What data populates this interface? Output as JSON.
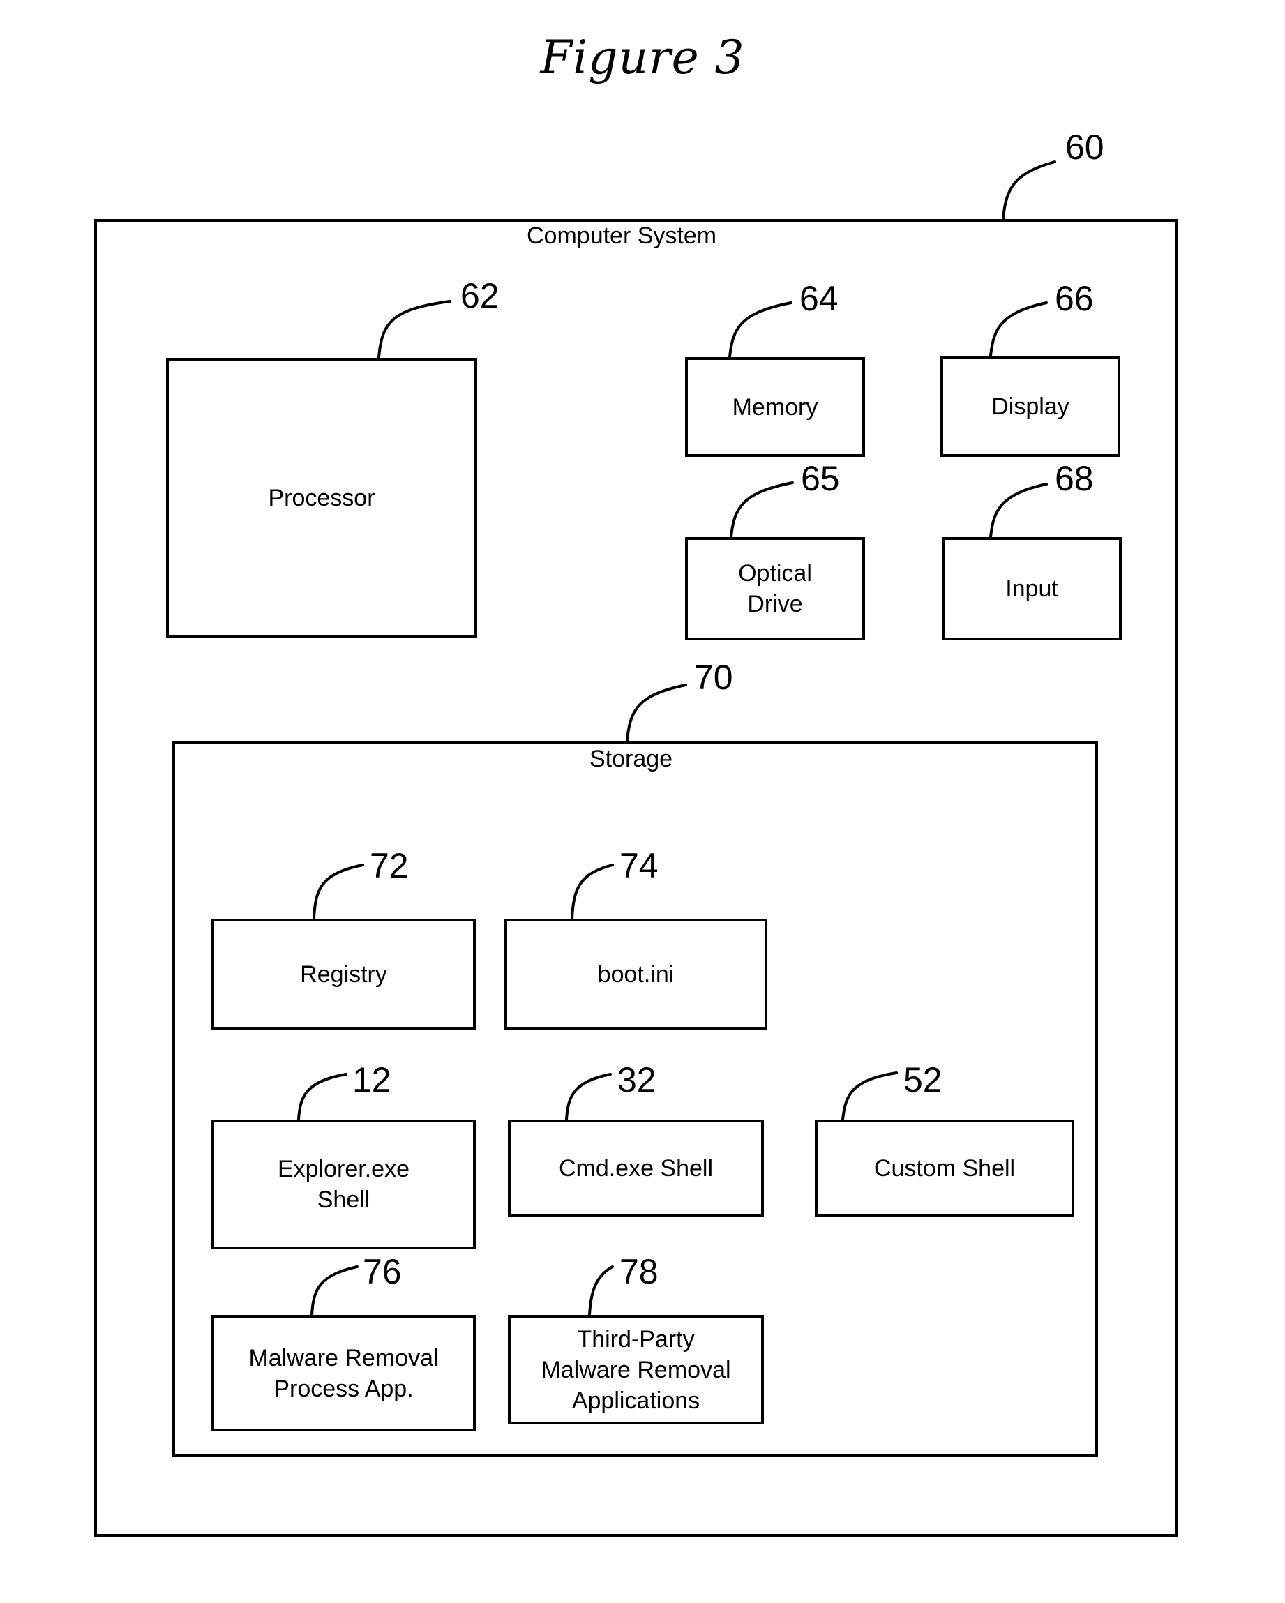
{
  "figure": {
    "title": "Figure 3"
  },
  "computer_system": {
    "title": "Computer System",
    "ref": "60",
    "components": [
      {
        "label": "Processor",
        "ref": "62"
      },
      {
        "label": "Memory",
        "ref": "64"
      },
      {
        "label": "Display",
        "ref": "66"
      },
      {
        "label": "Optical\nDrive",
        "ref": "65"
      },
      {
        "label": "Input",
        "ref": "68"
      }
    ],
    "storage": {
      "title": "Storage",
      "ref": "70",
      "items": [
        {
          "label": "Registry",
          "ref": "72"
        },
        {
          "label": "boot.ini",
          "ref": "74"
        },
        {
          "label": "Explorer.exe\nShell",
          "ref": "12"
        },
        {
          "label": "Cmd.exe Shell",
          "ref": "32"
        },
        {
          "label": "Custom Shell",
          "ref": "52"
        },
        {
          "label": "Malware Removal\nProcess App.",
          "ref": "76"
        },
        {
          "label": "Third-Party\nMalware Removal\nApplications",
          "ref": "78"
        }
      ]
    }
  },
  "colors": {
    "stroke": "#000000",
    "background": "#ffffff"
  }
}
